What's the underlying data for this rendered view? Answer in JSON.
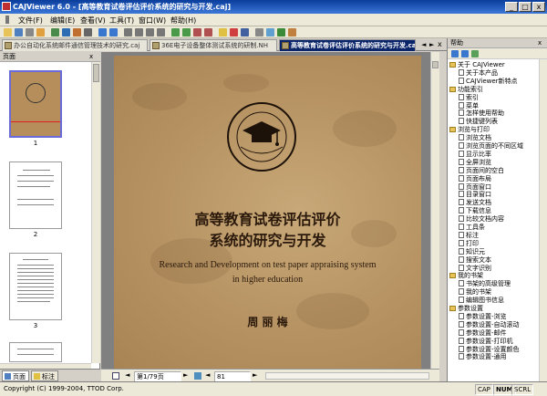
{
  "window": {
    "title": "CAJViewer 6.0 - [高等教育试卷评估评价系统的研究与开发.caj]",
    "minimize_glyph": "_",
    "maximize_glyph": "□",
    "close_glyph": "x"
  },
  "menu": [
    "文件(F)",
    "编辑(E)",
    "查看(V)",
    "工具(T)",
    "窗口(W)",
    "帮助(H)"
  ],
  "tabs": [
    {
      "label": "办公自动化系统邮件通信管理技术的研究.caj",
      "active": false
    },
    {
      "label": "36E电子设备整体测试系统的研制.NH",
      "active": false
    },
    {
      "label": "高等教育试卷评估评价系统的研究与开发.caj",
      "active": true
    }
  ],
  "pages_panel": {
    "title": "页面",
    "page_numbers": [
      "1",
      "2",
      "3"
    ],
    "bottom_tabs": [
      "页面",
      "标注"
    ]
  },
  "document": {
    "title_line1": "高等教育试卷评估评价",
    "title_line2": "系统的研究与开发",
    "en_line1": "Research and Development on test paper appraising system",
    "en_line2": "in higher education",
    "author": "周 丽 梅",
    "page_field": "第1/79页",
    "zoom_field": "81"
  },
  "help_panel": {
    "title": "帮助",
    "items": [
      {
        "label": "关于 CAJViewer",
        "type": "folder",
        "level": 0
      },
      {
        "label": "关于本产品",
        "type": "doc",
        "level": 1
      },
      {
        "label": "CAJViewer新特点",
        "type": "doc",
        "level": 1
      },
      {
        "label": "功能索引",
        "type": "folder",
        "level": 0
      },
      {
        "label": "索引",
        "type": "doc",
        "level": 1
      },
      {
        "label": "菜单",
        "type": "doc",
        "level": 1
      },
      {
        "label": "怎样使用帮助",
        "type": "doc",
        "level": 1
      },
      {
        "label": "快捷键列表",
        "type": "doc",
        "level": 1
      },
      {
        "label": "浏览与打印",
        "type": "folder",
        "level": 0
      },
      {
        "label": "浏览文档",
        "type": "doc",
        "level": 1
      },
      {
        "label": "浏览页面的不同区域",
        "type": "doc",
        "level": 1
      },
      {
        "label": "显示比率",
        "type": "doc",
        "level": 1
      },
      {
        "label": "全屏浏览",
        "type": "doc",
        "level": 1
      },
      {
        "label": "页面间的空白",
        "type": "doc",
        "level": 1
      },
      {
        "label": "页面布局",
        "type": "doc",
        "level": 1
      },
      {
        "label": "页面窗口",
        "type": "doc",
        "level": 1
      },
      {
        "label": "目录窗口",
        "type": "doc",
        "level": 1
      },
      {
        "label": "发送文档",
        "type": "doc",
        "level": 1
      },
      {
        "label": "下载信息",
        "type": "doc",
        "level": 1
      },
      {
        "label": "比较文档内容",
        "type": "doc",
        "level": 1
      },
      {
        "label": "工具条",
        "type": "doc",
        "level": 1
      },
      {
        "label": "标注",
        "type": "doc",
        "level": 1
      },
      {
        "label": "打印",
        "type": "doc",
        "level": 1
      },
      {
        "label": "知识元",
        "type": "doc",
        "level": 1
      },
      {
        "label": "搜索文本",
        "type": "doc",
        "level": 1
      },
      {
        "label": "文字识别",
        "type": "doc",
        "level": 1
      },
      {
        "label": "我的书架",
        "type": "folder",
        "level": 0
      },
      {
        "label": "书架的高级管理",
        "type": "doc",
        "level": 1
      },
      {
        "label": "我的书架",
        "type": "doc",
        "level": 1
      },
      {
        "label": "编辑图书信息",
        "type": "doc",
        "level": 1
      },
      {
        "label": "参数设置",
        "type": "folder",
        "level": 0
      },
      {
        "label": "参数设置-浏览",
        "type": "doc",
        "level": 1
      },
      {
        "label": "参数设置-自动滚动",
        "type": "doc",
        "level": 1
      },
      {
        "label": "参数设置-邮件",
        "type": "doc",
        "level": 1
      },
      {
        "label": "参数设置-打印机",
        "type": "doc",
        "level": 1
      },
      {
        "label": "参数设置-设置颜色",
        "type": "doc",
        "level": 1
      },
      {
        "label": "参数设置-通用",
        "type": "doc",
        "level": 1
      }
    ]
  },
  "status": {
    "copyright": "Copyright (C) 1999-2004, TTOD Corp.",
    "indicators": [
      "CAP",
      "NUM",
      "SCRL"
    ]
  }
}
